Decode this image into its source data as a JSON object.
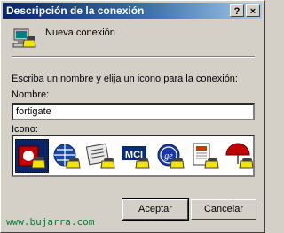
{
  "window": {
    "title": "Descripción de la conexión",
    "help_label": "?",
    "close_label": "×"
  },
  "header": {
    "connection_name": "Nueva conexión",
    "icon": "network-computer-phone-icon"
  },
  "form": {
    "instruction": "Escriba un nombre y elija un icono para la conexión:",
    "name_label": "Nombre:",
    "name_value": "fortigate",
    "icon_label": "Icono:"
  },
  "icons": [
    {
      "name": "red-phone-icon",
      "selected": true
    },
    {
      "name": "globe-phone-icon",
      "selected": false
    },
    {
      "name": "newspaper-phone-icon",
      "selected": false
    },
    {
      "name": "mci-logo-icon",
      "selected": false
    },
    {
      "name": "ge-logo-icon",
      "selected": false
    },
    {
      "name": "document-phone-icon",
      "selected": false
    },
    {
      "name": "umbrella-phone-icon",
      "selected": false
    }
  ],
  "buttons": {
    "ok": "Aceptar",
    "cancel": "Cancelar"
  },
  "watermark": "www.bujarra.com",
  "colors": {
    "titlebar_start": "#0a246a",
    "titlebar_end": "#a6caf0",
    "window_bg": "#d4d0c8",
    "watermark": "#0a7a36"
  }
}
